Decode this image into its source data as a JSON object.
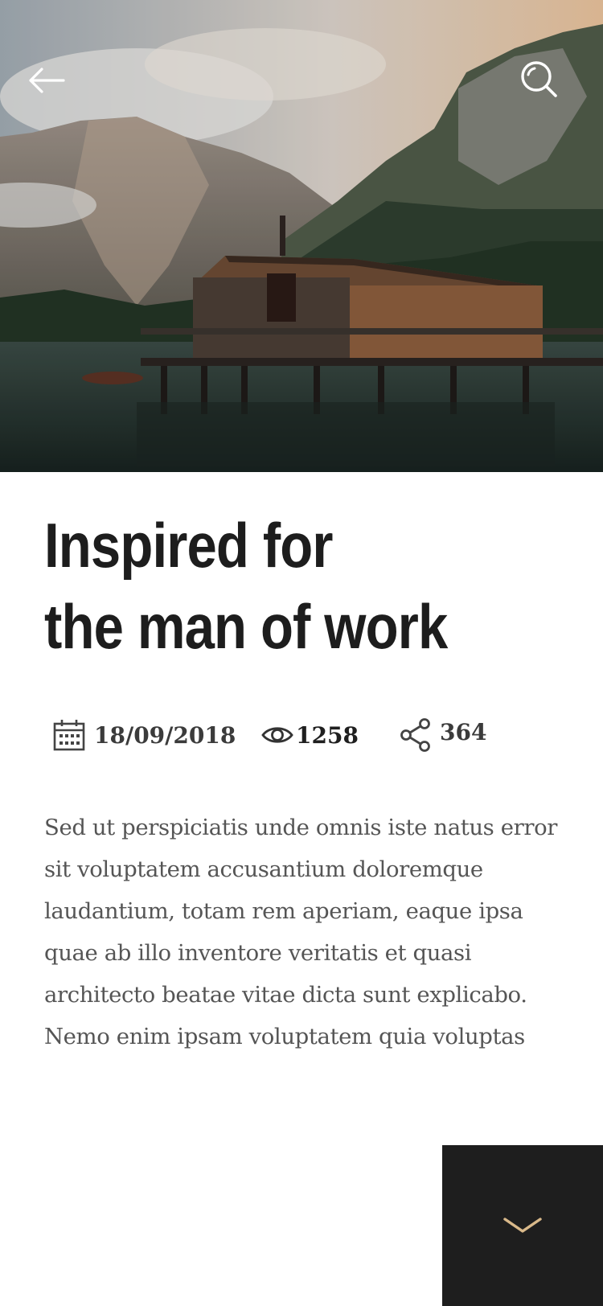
{
  "hero": {
    "back_icon": "arrow-left-icon",
    "search_icon": "search-icon"
  },
  "article": {
    "title_line1": "Inspired for",
    "title_line2": "the man of work",
    "meta": {
      "date_icon": "calendar-icon",
      "date": "18/09/2018",
      "views_icon": "eye-icon",
      "views": "1258",
      "shares_icon": "share-icon",
      "shares": "364"
    },
    "body_lines": [
      "Sed ut perspiciatis unde omnis iste natus error",
      "sit voluptatem accusantium doloremque",
      "laudantium, totam rem aperiam, eaque ipsa",
      "quae ab illo inventore veritatis et quasi",
      "architecto beatae vitae dicta sunt explicabo.",
      "Nemo enim ipsam voluptatem quia voluptas"
    ]
  },
  "scroll_button": {
    "icon": "chevron-down-icon",
    "accent_color": "#d9b98a"
  },
  "colors": {
    "title": "#1d1d1d",
    "body_text": "#555555",
    "dark_panel": "#1e1e1e"
  }
}
